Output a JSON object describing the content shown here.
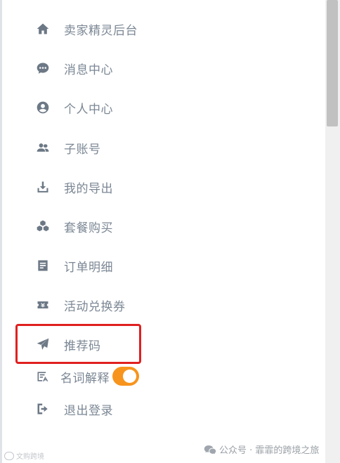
{
  "menu": {
    "items": [
      {
        "label": "卖家精灵后台",
        "icon": "home-icon"
      },
      {
        "label": "消息中心",
        "icon": "chat-bubble-icon"
      },
      {
        "label": "个人中心",
        "icon": "user-circle-icon"
      },
      {
        "label": "子账号",
        "icon": "users-icon"
      },
      {
        "label": "我的导出",
        "icon": "download-icon"
      },
      {
        "label": "套餐购买",
        "icon": "cubes-icon"
      },
      {
        "label": "订单明细",
        "icon": "file-list-icon"
      },
      {
        "label": "活动兑换券",
        "icon": "ticket-icon"
      },
      {
        "label": "推荐码",
        "icon": "paper-plane-icon"
      },
      {
        "label": "名词解释",
        "icon": "glossary-icon",
        "toggle": true
      },
      {
        "label": "退出登录",
        "icon": "sign-out-icon"
      }
    ]
  },
  "toggle": {
    "on": true,
    "color": "#f7941d"
  },
  "highlight": {
    "color": "#e02020"
  },
  "watermark": {
    "right_text": "公众号 · 霏霏的跨境之旅",
    "left_text": "文购跨境"
  }
}
